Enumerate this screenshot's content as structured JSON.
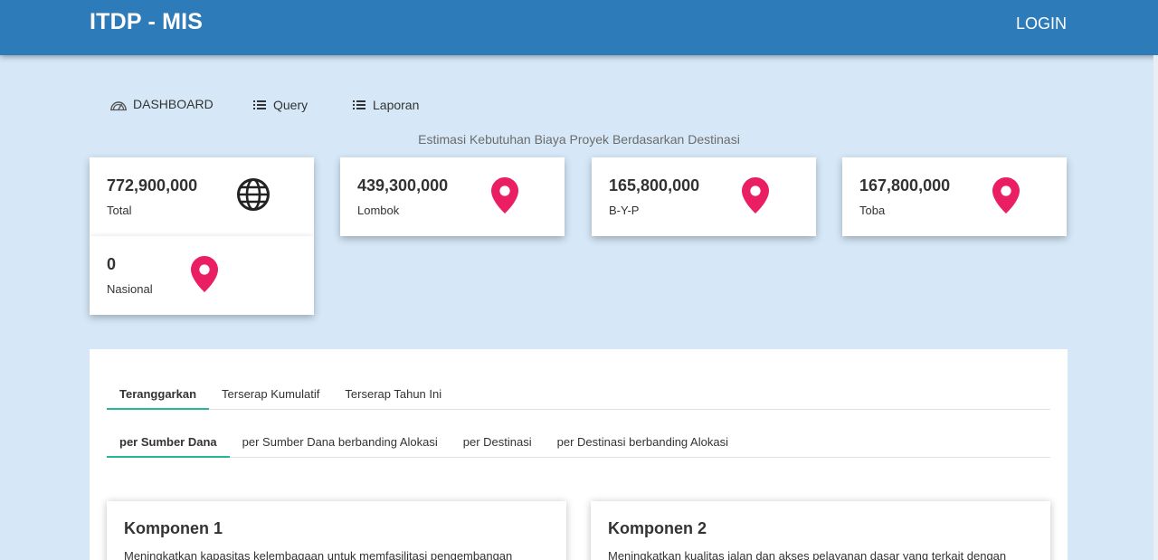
{
  "header": {
    "brand": "ITDP - MIS",
    "login_label": "LOGIN"
  },
  "menu": [
    {
      "label": "DASHBOARD",
      "icon": "dashboard-icon"
    },
    {
      "label": "Query",
      "icon": "list-icon"
    },
    {
      "label": "Laporan",
      "icon": "list-icon"
    }
  ],
  "section_title": "Estimasi Kebutuhan Biaya Proyek Berdasarkan Destinasi",
  "stats": [
    {
      "value": "772,900,000",
      "label": "Total",
      "icon": "globe-icon"
    },
    {
      "value": "439,300,000",
      "label": "Lombok",
      "icon": "map-marker-icon"
    },
    {
      "value": "165,800,000",
      "label": "B-Y-P",
      "icon": "map-marker-icon"
    },
    {
      "value": "167,800,000",
      "label": "Toba",
      "icon": "map-marker-icon"
    },
    {
      "value": "0",
      "label": "Nasional",
      "icon": "map-marker-icon"
    }
  ],
  "tabs_primary": [
    {
      "label": "Teranggarkan",
      "active": true
    },
    {
      "label": "Terserap Kumulatif",
      "active": false
    },
    {
      "label": "Terserap Tahun Ini",
      "active": false
    }
  ],
  "tabs_secondary": [
    {
      "label": "per Sumber Dana",
      "active": true
    },
    {
      "label": "per Sumber Dana berbanding Alokasi",
      "active": false
    },
    {
      "label": "per Destinasi",
      "active": false
    },
    {
      "label": "per Destinasi berbanding Alokasi",
      "active": false
    }
  ],
  "components": [
    {
      "title": "Komponen 1",
      "description": "Meningkatkan kapasitas kelembagaan untuk memfasilitasi pengembangan"
    },
    {
      "title": "Komponen 2",
      "description": "Meningkatkan kualitas jalan dan akses pelayanan dasar yang terkait dengan"
    }
  ],
  "colors": {
    "navbar": "#2e7bb9",
    "background": "#d6e8f8",
    "marker": "#e91e63",
    "tab_underline": "#26b69a"
  }
}
